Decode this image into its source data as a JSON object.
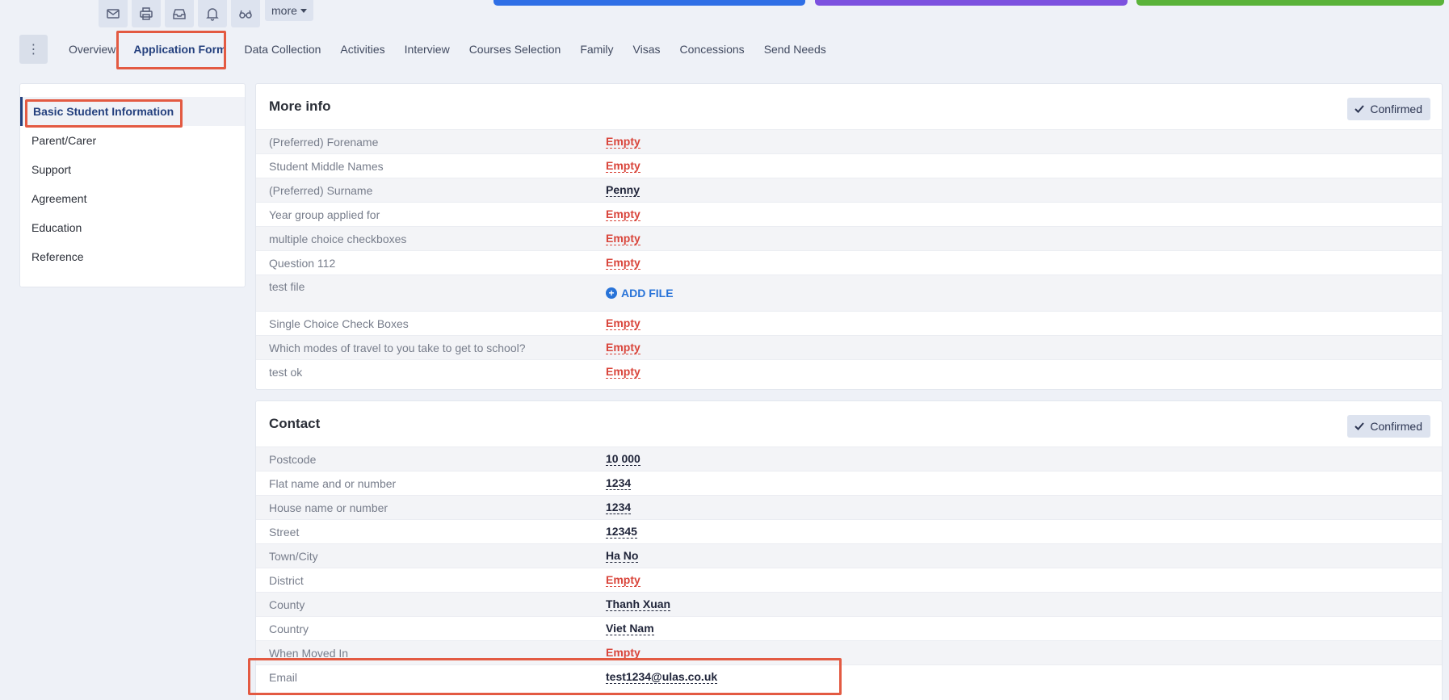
{
  "toolbar": {
    "icons": [
      "mail-icon",
      "printer-icon",
      "inbox-icon",
      "bell-icon",
      "glasses-icon"
    ],
    "more_label": "more"
  },
  "tabs": [
    "Overview",
    "Application Form",
    "Data Collection",
    "Activities",
    "Interview",
    "Courses Selection",
    "Family",
    "Visas",
    "Concessions",
    "Send Needs"
  ],
  "active_tab": "Application Form",
  "sidemenu": {
    "items": [
      "Basic Student Information",
      "Parent/Carer",
      "Support",
      "Agreement",
      "Education",
      "Reference"
    ],
    "active": "Basic Student Information"
  },
  "more_info": {
    "title": "More info",
    "confirm_label": "Confirmed",
    "rows": [
      {
        "label": "(Preferred) Forename",
        "value": "Empty"
      },
      {
        "label": "Student Middle Names",
        "value": "Empty"
      },
      {
        "label": "(Preferred) Surname",
        "value": "Penny"
      },
      {
        "label": "Year group applied for",
        "value": "Empty"
      },
      {
        "label": "multiple choice checkboxes",
        "value": "Empty"
      },
      {
        "label": "Question 112",
        "value": "Empty"
      },
      {
        "label": "test file",
        "value": "ADD FILE"
      },
      {
        "label": "Single Choice Check Boxes",
        "value": "Empty"
      },
      {
        "label": "Which modes of travel to you take to get to school?",
        "value": "Empty"
      },
      {
        "label": "test ok",
        "value": "Empty"
      }
    ]
  },
  "contact": {
    "title": "Contact",
    "confirm_label": "Confirmed",
    "rows": [
      {
        "label": "Postcode",
        "value": "10 000"
      },
      {
        "label": "Flat name and or number",
        "value": "1234"
      },
      {
        "label": "House name or number",
        "value": "1234"
      },
      {
        "label": "Street",
        "value": "12345"
      },
      {
        "label": "Town/City",
        "value": "Ha No"
      },
      {
        "label": "District",
        "value": "Empty"
      },
      {
        "label": "County",
        "value": "Thanh Xuan"
      },
      {
        "label": "Country",
        "value": "Viet Nam"
      },
      {
        "label": "When Moved In",
        "value": "Empty"
      },
      {
        "label": "Email",
        "value": "test1234@ulas.co.uk"
      }
    ]
  },
  "colors": {
    "accent_blue": "#2f6fe6",
    "accent_purple": "#7c51df",
    "accent_green": "#5ab33a",
    "empty_red": "#d9453b",
    "highlight": "#e35a42"
  }
}
